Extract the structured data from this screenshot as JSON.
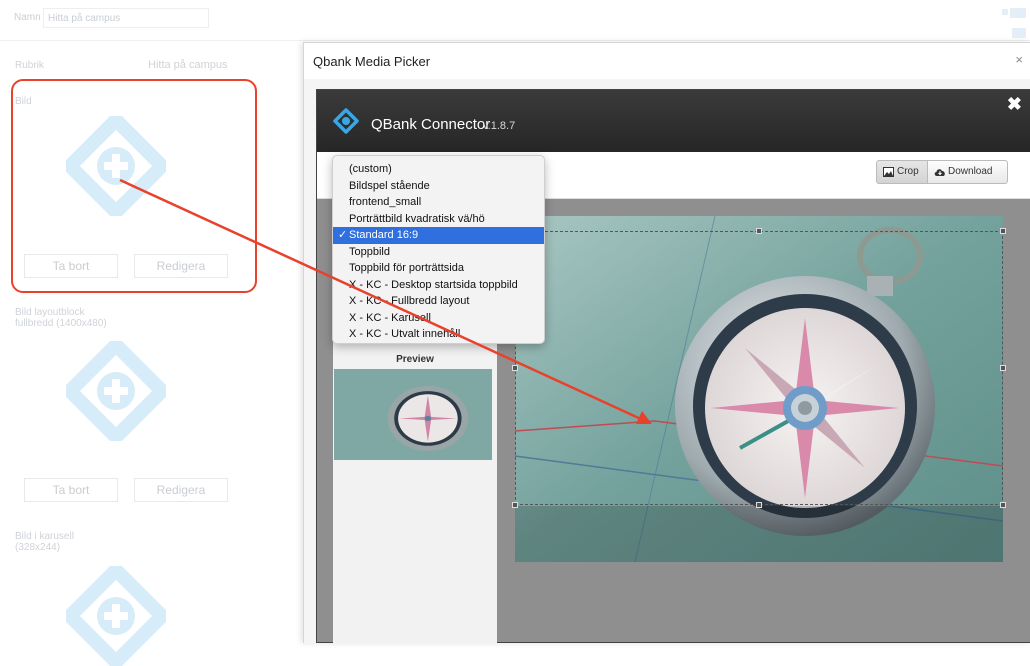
{
  "cms": {
    "namn_label": "Namn",
    "namn_value": "Hitta på campus",
    "rubrik_label": "Rubrik",
    "rubrik_value": "Hitta på campus",
    "bild_label": "Bild",
    "bild_layout_label_line1": "Bild layoutblock",
    "bild_layout_label_line2": "fullbredd (1400x480)",
    "bild_karusell_label_line1": "Bild i karusell",
    "bild_karusell_label_line2": "(328x244)",
    "remove_label": "Ta bort",
    "edit_label": "Redigera",
    "logo_color": "#d6ecf8",
    "highlight_color": "#e8412c"
  },
  "modal": {
    "title": "Qbank Media Picker",
    "close": "×"
  },
  "connector": {
    "title": "QBank Connector",
    "version": "v.1.8.7",
    "close": "✖",
    "crop_label": "Crop",
    "download_label": "Download",
    "preview_label": "Preview",
    "logo_color": "#38a7e8"
  },
  "dropdown": {
    "selected_index": 4,
    "check": "✓",
    "options": [
      "(custom)",
      "Bildspel stående",
      "frontend_small",
      "Porträttbild kvadratisk vä/hö",
      "Standard 16:9",
      "Toppbild",
      "Toppbild för porträttsida",
      "X - KC - Desktop startsida toppbild",
      "X - KC - Fullbredd layout",
      "X - KC - Karusell",
      "X - KC - Utvalt innehåll"
    ]
  },
  "annotation_arrow_color": "#e8412c"
}
